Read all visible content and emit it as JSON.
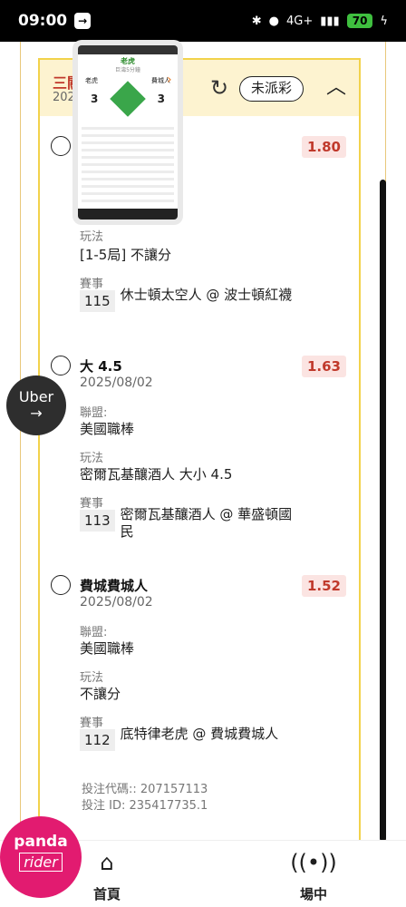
{
  "status_bar": {
    "time": "09:00",
    "battery": "70",
    "network": "4G+"
  },
  "card": {
    "title": "三關",
    "date": "2025",
    "status_pill": "未派彩",
    "refresh_icon": "refresh-icon",
    "collapse_icon": "chevron-up-icon"
  },
  "game_popup": {
    "team_name": "老虎",
    "sub": "巨濤5分鐘",
    "left_team": "老虎",
    "right_team": "費城人",
    "left_score": "3",
    "right_score": "3"
  },
  "bets": [
    {
      "odds": "1.80",
      "play_label": "玩法",
      "play_value": "[1-5局] 不讓分",
      "event_label": "賽事",
      "event_no": "115",
      "event_name": "休士頓太空人 @ 波士頓紅襪"
    },
    {
      "name": "大 4.5",
      "date": "2025/08/02",
      "odds": "1.63",
      "league_label": "聯盟:",
      "league_value": "美國職棒",
      "play_label": "玩法",
      "play_value": "密爾瓦基釀酒人 大小 4.5",
      "event_label": "賽事",
      "event_no": "113",
      "event_name": "密爾瓦基釀酒人 @ 華盛頓國民"
    },
    {
      "name": "費城費城人",
      "date": "2025/08/02",
      "odds": "1.52",
      "league_label": "聯盟:",
      "league_value": "美國職棒",
      "play_label": "玩法",
      "play_value": "不讓分",
      "event_label": "賽事",
      "event_no": "112",
      "event_name": "底特律老虎 @ 費城費城人"
    }
  ],
  "codes": {
    "bet_code": "投注代碼:: 207157113",
    "bet_id": "投注 ID: 235417735.1"
  },
  "uber": {
    "label": "Uber",
    "arrow": "→"
  },
  "panda": {
    "top": "panda",
    "bottom": "rider"
  },
  "nav": {
    "home_label": "首頁",
    "home_icon": "home-icon",
    "live_label": "場中",
    "live_icon": "live-broadcast-icon"
  }
}
